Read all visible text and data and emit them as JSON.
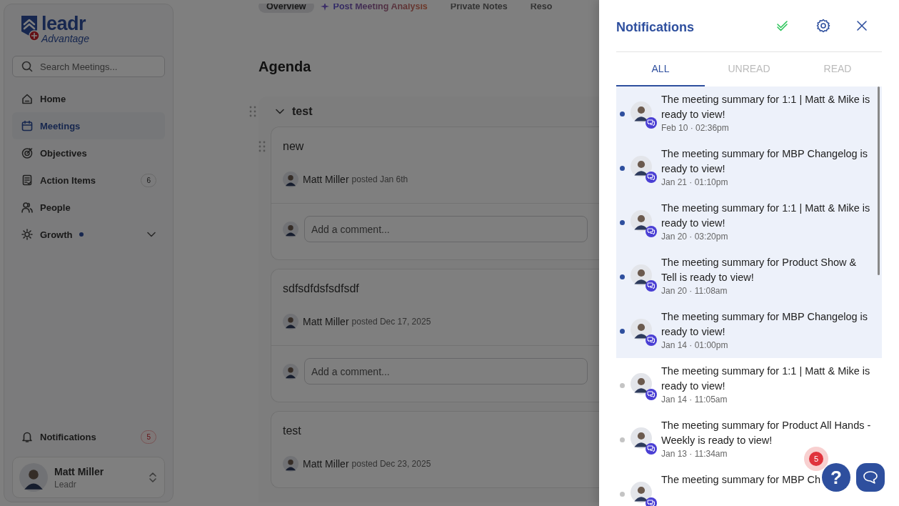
{
  "sidebar": {
    "logo": {
      "word": "leadr",
      "tagline": "Advantage"
    },
    "search": {
      "placeholder": "Search Meetings..."
    },
    "nav": [
      {
        "label": "Home",
        "selected": false
      },
      {
        "label": "Meetings",
        "selected": true
      },
      {
        "label": "Objectives",
        "selected": false
      },
      {
        "label": "Action Items",
        "selected": false,
        "badge": "6"
      },
      {
        "label": "People",
        "selected": false
      },
      {
        "label": "Growth",
        "selected": false,
        "dot": true,
        "expanded": false
      }
    ],
    "notifications": {
      "label": "Notifications",
      "badge": "5"
    },
    "user": {
      "name": "Matt Miller",
      "org": "Leadr"
    }
  },
  "meeting_tabs": [
    {
      "label": "Overview",
      "selected": true,
      "kind": "plain"
    },
    {
      "label": "Post Meeting Analysis",
      "selected": false,
      "kind": "ai"
    },
    {
      "label": "Private Notes",
      "selected": false,
      "kind": "plain"
    },
    {
      "label": "Reso",
      "selected": false,
      "kind": "plain"
    }
  ],
  "agenda": {
    "title": "Agenda",
    "section": {
      "title": "test",
      "expanded": true,
      "items": [
        {
          "title": "new",
          "author": "Matt Miller",
          "posted": "posted Jan 6th",
          "comment_placeholder": "Add a comment..."
        },
        {
          "title": "sdfsdfdsfsdfsdf",
          "author": "Matt Miller",
          "posted": "posted Dec 17, 2025",
          "comment_placeholder": "Add a comment..."
        },
        {
          "title": "test",
          "author": "Matt Miller",
          "posted": "posted Dec 23, 2025"
        }
      ]
    }
  },
  "drawer": {
    "title": "Notifications",
    "tabs": [
      {
        "label": "ALL",
        "selected": true
      },
      {
        "label": "UNREAD",
        "selected": false
      },
      {
        "label": "READ",
        "selected": false
      }
    ],
    "items": [
      {
        "text": "The meeting summary for 1:1 | Matt & Mike is ready to view!",
        "time": "Feb 10 · 02:36pm",
        "unread": true
      },
      {
        "text": "The meeting summary for MBP Changelog is ready to view!",
        "time": "Jan 21 · 01:10pm",
        "unread": true
      },
      {
        "text": "The meeting summary for 1:1 | Matt & Mike is ready to view!",
        "time": "Jan 20 · 03:20pm",
        "unread": true
      },
      {
        "text": "The meeting summary for Product Show & Tell is ready to view!",
        "time": "Jan 20 · 11:08am",
        "unread": true
      },
      {
        "text": "The meeting summary for MBP Changelog is ready to view!",
        "time": "Jan 14 · 01:00pm",
        "unread": true
      },
      {
        "text": "The meeting summary for 1:1 | Matt & Mike is ready to view!",
        "time": "Jan 14 · 11:05am",
        "unread": false
      },
      {
        "text": "The meeting summary for Product All Hands - Weekly is ready to view!",
        "time": "Jan 13 · 11:34am",
        "unread": false
      },
      {
        "text": "The meeting summary for MBP Ch",
        "unread": false
      }
    ]
  },
  "help": {
    "label": "?",
    "badge": "5"
  }
}
